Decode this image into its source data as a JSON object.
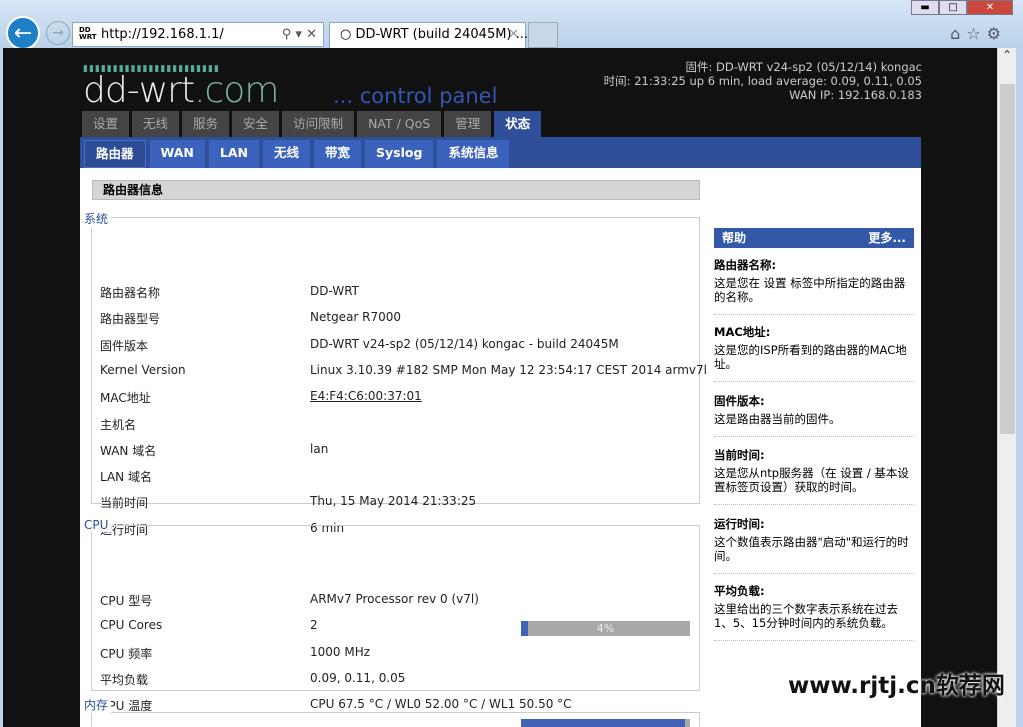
{
  "browser": {
    "url": "http://192.168.1.1/",
    "tab_title": "DD-WRT (build 24045M) ...",
    "favicon_text": "DD WRT"
  },
  "header": {
    "logo_main": "dd-wrt",
    "logo_com": ".com",
    "logo_sub": "... control panel",
    "firmware": "固件: DD-WRT v24-sp2 (05/12/14) kongac",
    "time": "时间: 21:33:25 up 6 min, load average: 0.09, 0.11, 0.05",
    "wan_ip": "WAN IP: 192.168.0.183"
  },
  "main_tabs": [
    "设置",
    "无线",
    "服务",
    "安全",
    "访问限制",
    "NAT / QoS",
    "管理",
    "状态"
  ],
  "sub_tabs": [
    "路由器",
    "WAN",
    "LAN",
    "无线",
    "带宽",
    "Syslog",
    "系统信息"
  ],
  "section_title": "路由器信息",
  "system": {
    "legend": "系统",
    "rows": [
      {
        "label": "路由器名称",
        "value": "DD-WRT"
      },
      {
        "label": "路由器型号",
        "value": "Netgear R7000"
      },
      {
        "label": "固件版本",
        "value": "DD-WRT v24-sp2 (05/12/14) kongac - build 24045M"
      },
      {
        "label": "Kernel Version",
        "value": "Linux 3.10.39 #182 SMP Mon May 12 23:54:17 CEST 2014 armv7l"
      },
      {
        "label": "MAC地址",
        "value": "E4:F4:C6:00:37:01"
      },
      {
        "label": "主机名",
        "value": ""
      },
      {
        "label": "WAN 域名",
        "value": "lan"
      },
      {
        "label": "LAN 域名",
        "value": ""
      },
      {
        "label": "当前时间",
        "value": "Thu, 15 May 2014 21:33:25"
      },
      {
        "label": "运行时间",
        "value": "6 min"
      }
    ]
  },
  "cpu": {
    "legend": "CPU",
    "rows": [
      {
        "label": "CPU 型号",
        "value": "ARMv7 Processor rev 0 (v7l)"
      },
      {
        "label": "CPU Cores",
        "value": "2"
      },
      {
        "label": "CPU 频率",
        "value": "1000 MHz"
      },
      {
        "label": "平均负载",
        "value": "0.09, 0.11, 0.05"
      },
      {
        "label": "CPU 温度",
        "value": "CPU 67.5 °C / WL0 52.00 °C / WL1 50.50 °C"
      }
    ],
    "load_percent": 4,
    "load_label": "4%"
  },
  "memory": {
    "legend": "内存",
    "bar_percent": 97
  },
  "help": {
    "title": "帮助",
    "more": "更多...",
    "items": [
      {
        "title": "路由器名称:",
        "text": "这是您在 设置 标签中所指定的路由器的名称。"
      },
      {
        "title": "MAC地址:",
        "text": "这是您的ISP所看到的路由器的MAC地址。"
      },
      {
        "title": "固件版本:",
        "text": "这是路由器当前的固件。"
      },
      {
        "title": "当前时间:",
        "text": "这是您从ntp服务器（在 设置 / 基本设置标签页设置）获取的时间。"
      },
      {
        "title": "运行时间:",
        "text": "这个数值表示路由器\"启动\"和运行的时间。"
      },
      {
        "title": "平均负载:",
        "text": "这里给出的三个数字表示系统在过去1、5、15分钟时间内的系统负载。"
      }
    ]
  },
  "watermark": "www.rjtj.cn软荐网"
}
